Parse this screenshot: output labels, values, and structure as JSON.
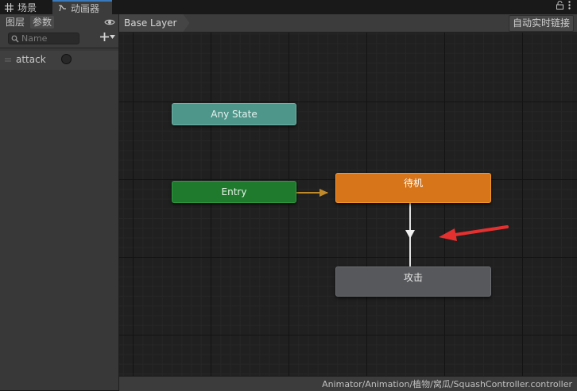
{
  "tabs": {
    "scene": "场景",
    "animator": "动画器"
  },
  "left_panel": {
    "tabs": {
      "layers": "图层",
      "parameters": "参数"
    },
    "search": {
      "placeholder": "Name",
      "value": ""
    },
    "parameters": [
      {
        "name": "attack",
        "type": "trigger"
      }
    ]
  },
  "graph": {
    "breadcrumb": "Base Layer",
    "auto_live_link": "自动实时链接",
    "states": {
      "any_state": "Any State",
      "entry": "Entry",
      "idle": "待机",
      "attack": "攻击"
    },
    "transitions": [
      {
        "from": "entry",
        "to": "idle",
        "color": "#c08a2a"
      },
      {
        "from": "idle",
        "to": "attack",
        "color": "#e0e0e0"
      }
    ],
    "annotation_arrow_color": "#e53030"
  },
  "status": {
    "path": "Animator/Animation/植物/窝瓜/SquashController.controller"
  },
  "colors": {
    "any_state": "#4e958a",
    "entry": "#1f7a2e",
    "idle_default": "#d7751a",
    "state": "#56585b",
    "accent_tab": "#3a79bb"
  },
  "icons": [
    "grid-icon",
    "animator-icon",
    "lock-icon",
    "more-icon",
    "eye-icon",
    "search-icon",
    "plus-icon",
    "dropdown-icon",
    "drag-handle-icon"
  ]
}
